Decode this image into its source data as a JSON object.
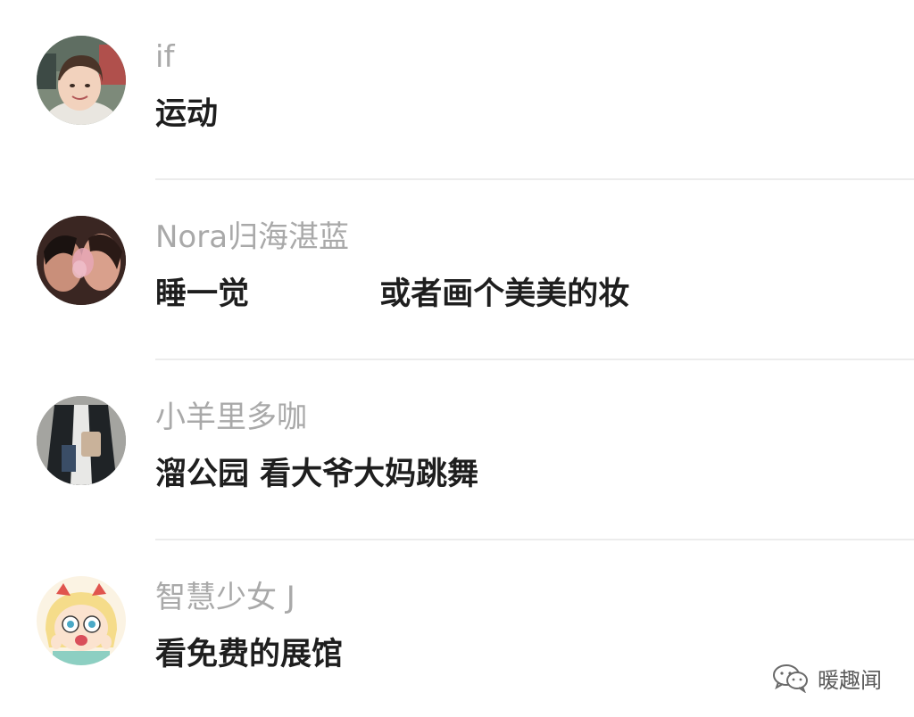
{
  "comments": [
    {
      "username": "if",
      "content": "运动",
      "avatar_icon": "avatar-photo-smiling-girl"
    },
    {
      "username": "Nora归海湛蓝",
      "content": "睡一觉            或者画个美美的妆",
      "avatar_icon": "avatar-photo-couple-smoke"
    },
    {
      "username": "小羊里多咖",
      "content": "溜公园 看大爷大妈跳舞",
      "avatar_icon": "avatar-photo-person-jacket"
    },
    {
      "username": "智慧少女 J",
      "content": "看免费的展馆",
      "avatar_icon": "avatar-cartoon-girl"
    }
  ],
  "watermark": {
    "text": "暖趣闻",
    "icon": "wechat-logo-icon"
  },
  "colors": {
    "username": "#a9a9a9",
    "content": "#1e1e1e",
    "divider": "#ececec",
    "background": "#ffffff"
  }
}
